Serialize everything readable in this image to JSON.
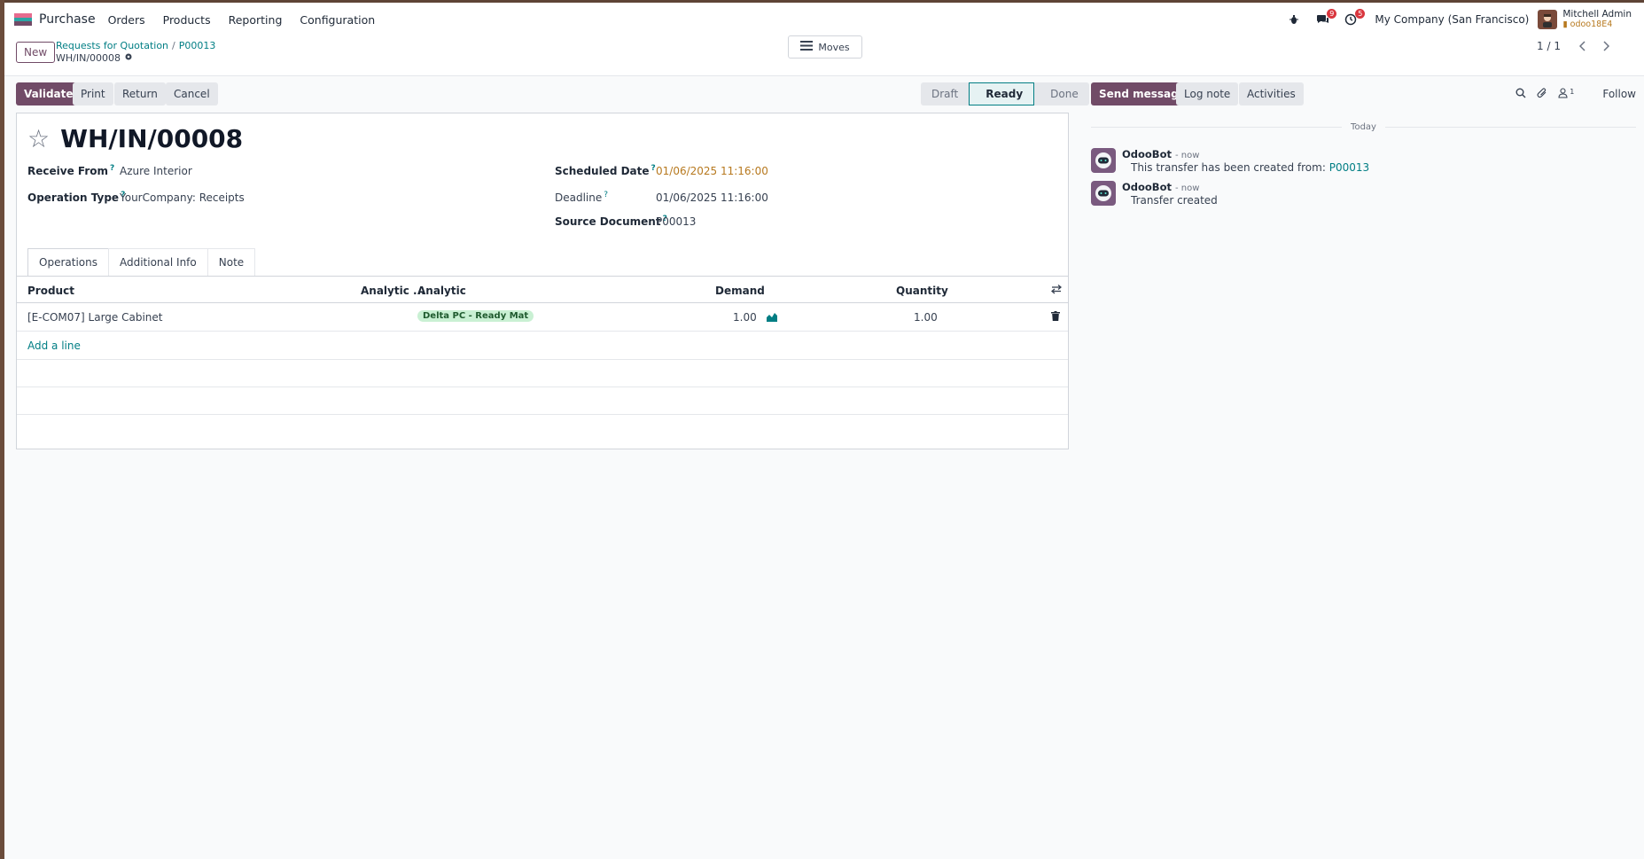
{
  "navbar": {
    "app_name": "Purchase",
    "menus": [
      "Orders",
      "Products",
      "Reporting",
      "Configuration"
    ],
    "messages_badge": "9",
    "activities_badge": "5",
    "company": "My Company (San Francisco)",
    "user_name": "Mitchell Admin",
    "database": "odoo18E4"
  },
  "control_panel": {
    "new_label": "New",
    "breadcrumb": [
      "Requests for Quotation",
      "P00013"
    ],
    "record_name": "WH/IN/00008",
    "moves_label": "Moves",
    "pager": "1 / 1"
  },
  "actions": {
    "validate": "Validate",
    "print": "Print",
    "return": "Return",
    "cancel": "Cancel"
  },
  "status": {
    "steps": [
      "Draft",
      "Ready",
      "Done"
    ],
    "active": "Ready"
  },
  "form": {
    "title": "WH/IN/00008",
    "receive_from_label": "Receive From",
    "receive_from": "Azure Interior",
    "operation_type_label": "Operation Type",
    "operation_type": "YourCompany: Receipts",
    "scheduled_date_label": "Scheduled Date",
    "scheduled_date": "01/06/2025 11:16:00",
    "deadline_label": "Deadline",
    "deadline": "01/06/2025 11:16:00",
    "source_document_label": "Source Document",
    "source_document": "P00013",
    "help_mark": "?"
  },
  "tabs": [
    "Operations",
    "Additional Info",
    "Note"
  ],
  "table": {
    "headers": {
      "product": "Product",
      "analytic_short": "Analytic ...",
      "analytic": "Analytic",
      "demand": "Demand",
      "quantity": "Quantity"
    },
    "rows": [
      {
        "product": "[E-COM07] Large Cabinet",
        "analytic_tag": "Delta PC - Ready Mat",
        "demand": "1.00",
        "quantity": "1.00"
      }
    ],
    "add_line": "Add a line"
  },
  "chatter": {
    "send_message": "Send message",
    "log_note": "Log note",
    "activities": "Activities",
    "followers_count": "1",
    "follow": "Follow",
    "today": "Today",
    "messages": [
      {
        "author": "OdooBot",
        "time": "- now",
        "text": "This transfer has been created from:",
        "link": "P00013"
      },
      {
        "author": "OdooBot",
        "time": "- now",
        "text": "Transfer created"
      }
    ]
  },
  "colors": {
    "primary": "#714b67",
    "link": "#017e84",
    "warning": "#b7791f",
    "badge": "#d9363e",
    "tag": "#c9f0d3"
  }
}
